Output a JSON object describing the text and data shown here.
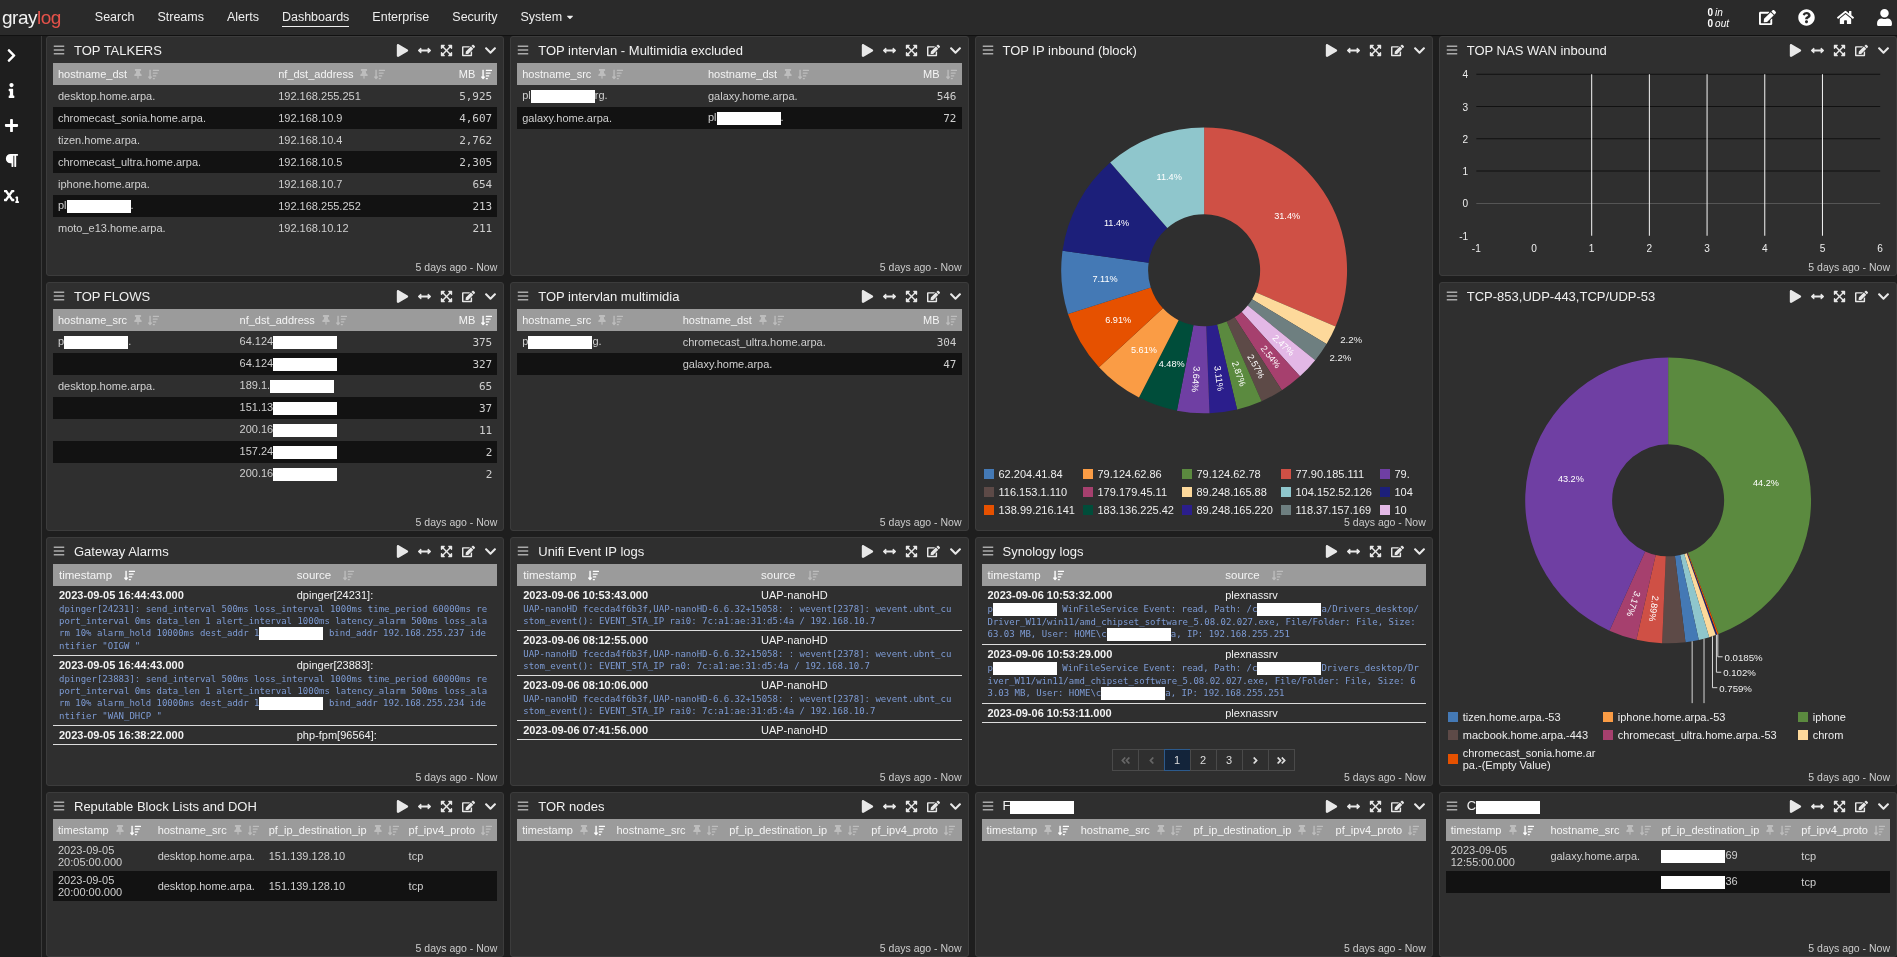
{
  "top_nav": {
    "logo": {
      "first": "gray",
      "second": "log"
    },
    "items": [
      {
        "label": "Search",
        "selected": false,
        "dropdown": false
      },
      {
        "label": "Streams",
        "selected": false,
        "dropdown": false
      },
      {
        "label": "Alerts",
        "selected": false,
        "dropdown": false
      },
      {
        "label": "Dashboards",
        "selected": true,
        "dropdown": false
      },
      {
        "label": "Enterprise",
        "selected": false,
        "dropdown": false
      },
      {
        "label": "Security",
        "selected": false,
        "dropdown": false
      },
      {
        "label": "System",
        "selected": false,
        "dropdown": true
      }
    ],
    "throughput": {
      "in_count": "0",
      "in_label": "in",
      "out_count": "0",
      "out_label": "out"
    }
  },
  "panels": [
    {
      "kind": "table",
      "title": "TOP TALKERS",
      "time_range": "5 days ago - Now",
      "columns": [
        {
          "label": "hostname_dst",
          "pin": true,
          "sorted": false,
          "kind": "text"
        },
        {
          "label": "nf_dst_address",
          "pin": true,
          "sorted": false,
          "kind": "text"
        },
        {
          "label": "MB",
          "pin": false,
          "sorted": true,
          "kind": "number"
        }
      ],
      "rows": [
        [
          "desktop.home.arpa.",
          "192.168.255.251",
          "5,925"
        ],
        [
          "chromecast_sonia.home.arpa.",
          "192.168.10.9",
          "4,607"
        ],
        [
          "tizen.home.arpa.",
          "192.168.10.4",
          "2,762"
        ],
        [
          "chromecast_ultra.home.arpa.",
          "192.168.10.5",
          "2,305"
        ],
        [
          "iphone.home.arpa.",
          "192.168.10.7",
          "654"
        ],
        [
          [
            {
              "kind": "text",
              "text": "pl"
            },
            {
              "kind": "redaction"
            },
            {
              "kind": "text",
              "text": "."
            }
          ],
          "192.168.255.252",
          "213"
        ],
        [
          "moto_e13.home.arpa.",
          "192.168.10.12",
          "211"
        ]
      ]
    },
    {
      "kind": "table",
      "title": "TOP intervlan - Multimidia excluded",
      "time_range": "5 days ago - Now",
      "columns": [
        {
          "label": "hostname_src",
          "pin": true,
          "sorted": false,
          "kind": "text"
        },
        {
          "label": "hostname_dst",
          "pin": true,
          "sorted": false,
          "kind": "text"
        },
        {
          "label": "MB",
          "pin": false,
          "sorted": false,
          "kind": "number"
        }
      ],
      "rows": [
        [
          [
            {
              "kind": "text",
              "text": "pl"
            },
            {
              "kind": "redaction"
            },
            {
              "kind": "text",
              "text": "rg."
            }
          ],
          "galaxy.home.arpa.",
          "546"
        ],
        [
          "galaxy.home.arpa.",
          [
            {
              "kind": "text",
              "text": "pl"
            },
            {
              "kind": "redaction"
            },
            {
              "kind": "text",
              "text": "."
            }
          ],
          "72"
        ]
      ]
    },
    {
      "kind": "donut",
      "title": "TOP IP inbound (block)",
      "time_range": "5 days ago - Now",
      "chart_data": {
        "type": "donut",
        "values": [
          31.4,
          2.2,
          2.2,
          2.47,
          2.54,
          2.57,
          2.87,
          3.11,
          3.64,
          4.48,
          5.61,
          6.91,
          7.11,
          11.4,
          11.4
        ],
        "value_labels": [
          "31.4%",
          "2.2%",
          "2.2%",
          "2.47%",
          "2.54%",
          "2.57%",
          "2.87%",
          "3.11%",
          "3.64%",
          "4.48%",
          "5.61%",
          "6.91%",
          "7.11%",
          "11.4%",
          "11.4%"
        ],
        "colors": [
          "#cf5045",
          "#fdd99b",
          "#6e7f80",
          "#e3b8e6",
          "#a6406e",
          "#5d4a47",
          "#5b8a3f",
          "#2b1e8c",
          "#6f3fa3",
          "#004d3a",
          "#fa9c45",
          "#e65100",
          "#4479b5",
          "#1c1f7a",
          "#8fc6cc"
        ]
      },
      "legend": [
        {
          "name": "62.204.41.84",
          "color": "#4479b5"
        },
        {
          "name": "79.124.62.86",
          "color": "#fa9c45"
        },
        {
          "name": "79.124.62.78",
          "color": "#5b8a3f"
        },
        {
          "name": "77.90.185.111",
          "color": "#cf5045"
        },
        {
          "name": "79.",
          "color": "#6f3fa3"
        },
        {
          "name": "116.153.1.110",
          "color": "#5d4a47"
        },
        {
          "name": "179.179.45.11",
          "color": "#a6406e"
        },
        {
          "name": "89.248.165.88",
          "color": "#fdd99b"
        },
        {
          "name": "104.152.52.126",
          "color": "#8fc6cc"
        },
        {
          "name": "104",
          "color": "#1c1f7a"
        },
        {
          "name": "138.99.216.141",
          "color": "#e65100"
        },
        {
          "name": "183.136.225.42",
          "color": "#004d3a"
        },
        {
          "name": "89.248.165.220",
          "color": "#2b1e8c"
        },
        {
          "name": "118.37.157.169",
          "color": "#6e7f80"
        },
        {
          "name": "10",
          "color": "#e3b8e6"
        }
      ]
    },
    {
      "kind": "line",
      "title": "TOP NAS WAN inbound",
      "time_range": "5 days ago - Now",
      "chart_data": {
        "type": "line",
        "xlim": [
          -1,
          6
        ],
        "ylim": [
          -1,
          4
        ],
        "xticks": [
          -1,
          0,
          1,
          2,
          3,
          4,
          5,
          6
        ],
        "yticks": [
          -1,
          0,
          1,
          2,
          3,
          4
        ],
        "grid": true
      }
    },
    {
      "kind": "table",
      "title": "TOP FLOWS",
      "time_range": "5 days ago - Now",
      "columns": [
        {
          "label": "hostname_src",
          "pin": true,
          "sorted": false,
          "kind": "text"
        },
        {
          "label": "nf_dst_address",
          "pin": true,
          "sorted": false,
          "kind": "text"
        },
        {
          "label": "MB",
          "pin": false,
          "sorted": true,
          "kind": "number"
        }
      ],
      "rows": [
        [
          [
            {
              "kind": "text",
              "text": "p"
            },
            {
              "kind": "redaction"
            },
            {
              "kind": "text",
              "text": "."
            }
          ],
          [
            {
              "kind": "text",
              "text": "64.124"
            },
            {
              "kind": "redaction"
            }
          ],
          "375"
        ],
        [
          null,
          [
            {
              "kind": "text",
              "text": "64.124"
            },
            {
              "kind": "redaction"
            }
          ],
          "327"
        ],
        [
          "desktop.home.arpa.",
          [
            {
              "kind": "text",
              "text": "189.1."
            },
            {
              "kind": "redaction"
            }
          ],
          "65"
        ],
        [
          null,
          [
            {
              "kind": "text",
              "text": "151.13"
            },
            {
              "kind": "redaction"
            }
          ],
          "37"
        ],
        [
          null,
          [
            {
              "kind": "text",
              "text": "200.16"
            },
            {
              "kind": "redaction"
            }
          ],
          "11"
        ],
        [
          null,
          [
            {
              "kind": "text",
              "text": "157.24"
            },
            {
              "kind": "redaction"
            }
          ],
          "2"
        ],
        [
          null,
          [
            {
              "kind": "text",
              "text": "200.16"
            },
            {
              "kind": "redaction"
            }
          ],
          "2"
        ]
      ]
    },
    {
      "kind": "table",
      "title": "TOP intervlan multimidia",
      "time_range": "5 days ago - Now",
      "columns": [
        {
          "label": "hostname_src",
          "pin": true,
          "sorted": false,
          "kind": "text"
        },
        {
          "label": "hostname_dst",
          "pin": true,
          "sorted": false,
          "kind": "text"
        },
        {
          "label": "MB",
          "pin": false,
          "sorted": false,
          "kind": "number"
        }
      ],
      "rows": [
        [
          [
            {
              "kind": "text",
              "text": "p"
            },
            {
              "kind": "redaction"
            },
            {
              "kind": "text",
              "text": "g."
            }
          ],
          "chromecast_ultra.home.arpa.",
          "304"
        ],
        [
          null,
          "galaxy.home.arpa.",
          "47"
        ]
      ]
    },
    {
      "kind": "messages",
      "title": "Gateway Alarms",
      "time_range": "5 days ago - Now",
      "columns": [
        {
          "label": "timestamp",
          "sorted": true
        },
        {
          "label": "source",
          "sorted": false
        }
      ],
      "messages": [
        {
          "timestamp": "2023-09-05 16:44:43.000",
          "source": "dpinger[24231]:",
          "message": [
            {
              "kind": "text",
              "text": "dpinger[24231]: send_interval 500ms loss_interval 1000ms time_period 60000ms report_interval 0ms data_len 1 alert_interval 1000ms latency_alarm 500ms loss_alarm 10% alarm_hold 10000ms dest_addr 1"
            },
            {
              "kind": "redaction"
            },
            {
              "kind": "text",
              "text": " bind_addr 192.168.255.237 identifier \"OIGW \""
            }
          ]
        },
        {
          "timestamp": "2023-09-05 16:44:43.000",
          "source": "dpinger[23883]:",
          "message": [
            {
              "kind": "text",
              "text": "dpinger[23883]: send_interval 500ms loss_interval 1000ms time_period 60000ms report_interval 0ms data_len 1 alert_interval 1000ms latency_alarm 500ms loss_alarm 10% alarm_hold 10000ms dest_addr 1"
            },
            {
              "kind": "redaction"
            },
            {
              "kind": "text",
              "text": " bind_addr 192.168.255.234 identifier \"WAN_DHCP \""
            }
          ]
        },
        {
          "timestamp": "2023-09-05 16:38:22.000",
          "source": "php-fpm[96564]:"
        }
      ]
    },
    {
      "kind": "messages",
      "title": "Unifi Event IP logs",
      "time_range": "5 days ago - Now",
      "columns": [
        {
          "label": "timestamp",
          "sorted": true
        },
        {
          "label": "source",
          "sorted": false
        }
      ],
      "messages": [
        {
          "timestamp": "2023-09-06 10:53:43.000",
          "source": "UAP-nanoHD",
          "message": "UAP-nanoHD fcecda4f6b3f,UAP-nanoHD-6.6.32+15058: : wevent[2378]: wevent.ubnt_custom_event(): EVENT_STA_IP rai0: 7c:a1:ae:31:d5:4a / 192.168.10.7"
        },
        {
          "timestamp": "2023-09-06 08:12:55.000",
          "source": "UAP-nanoHD",
          "message": "UAP-nanoHD fcecda4f6b3f,UAP-nanoHD-6.6.32+15058: : wevent[2378]: wevent.ubnt_custom_event(): EVENT_STA_IP ra0: 7c:a1:ae:31:d5:4a / 192.168.10.7"
        },
        {
          "timestamp": "2023-09-06 08:10:06.000",
          "source": "UAP-nanoHD",
          "message": "UAP-nanoHD fcecda4f6b3f,UAP-nanoHD-6.6.32+15058: : wevent[2378]: wevent.ubnt_custom_event(): EVENT_STA_IP rai0: 7c:a1:ae:31:d5:4a / 192.168.10.7"
        },
        {
          "timestamp": "2023-09-06 07:41:56.000",
          "source": "UAP-nanoHD"
        }
      ]
    },
    {
      "kind": "messages",
      "title": "Synology logs",
      "time_range": "5 days ago - Now",
      "columns": [
        {
          "label": "timestamp",
          "sorted": true
        },
        {
          "label": "source",
          "sorted": false
        }
      ],
      "messages": [
        {
          "timestamp": "2023-09-06 10:53:32.000",
          "source": "plexnassrv",
          "message": [
            {
              "kind": "text",
              "text": "p"
            },
            {
              "kind": "redaction"
            },
            {
              "kind": "text",
              "text": " WinFileService Event: read, Path: /c"
            },
            {
              "kind": "redaction"
            },
            {
              "kind": "text",
              "text": "a/Drivers_desktop/Driver_W11/win11/amd_chipset_software_5.08.02.027.exe, File/Folder: File, Size: 63.03 MB, User: HOME\\c"
            },
            {
              "kind": "redaction"
            },
            {
              "kind": "text",
              "text": "a, IP: 192.168.255.251"
            }
          ]
        },
        {
          "timestamp": "2023-09-06 10:53:29.000",
          "source": "plexnassrv",
          "message": [
            {
              "kind": "text",
              "text": "p"
            },
            {
              "kind": "redaction"
            },
            {
              "kind": "text",
              "text": " WinFileService Event: read, Path: /c"
            },
            {
              "kind": "redaction"
            },
            {
              "kind": "text",
              "text": "Drivers_desktop/Driver_W11/win11/amd_chipset_software_5.08.02.027.exe, File/Folder: File, Size: 63.03 MB, User: HOME\\c"
            },
            {
              "kind": "redaction"
            },
            {
              "kind": "text",
              "text": "a, IP: 192.168.255.251"
            }
          ]
        },
        {
          "timestamp": "2023-09-06 10:53:11.000",
          "source": "plexnassrv"
        }
      ],
      "pagination": {
        "prev_disabled": true,
        "next_disabled": false,
        "pages": [
          {
            "label": "1",
            "selected": true
          },
          {
            "label": "2",
            "selected": false
          },
          {
            "label": "3",
            "selected": false
          }
        ]
      }
    },
    {
      "kind": "donut",
      "title": "TCP-853,UDP-443,TCP/UDP-53",
      "time_range": "5 days ago - Now",
      "chart_data": {
        "type": "donut",
        "values": [
          44.2,
          0.0185,
          0.102,
          0.759,
          1.2,
          1.5,
          2.6,
          2.89,
          3.17,
          43.2
        ],
        "value_labels": [
          "44.2%",
          "0.0185%",
          "0.102%",
          "0.759%",
          null,
          null,
          null,
          "2.89%",
          "3.17%",
          "43.2%"
        ],
        "colors": [
          "#5b8a3f",
          "#e65100",
          "#1c1f7a",
          "#fdd99b",
          "#8fc6cc",
          "#4479b5",
          "#5d4a47",
          "#cf5045",
          "#a6406e",
          "#6f3fa3"
        ]
      },
      "legend": [
        {
          "name": "tizen.home.arpa.-53",
          "color": "#4479b5"
        },
        {
          "name": "iphone.home.arpa.-53",
          "color": "#fa9c45"
        },
        {
          "name": "iphone",
          "color": "#5b8a3f"
        },
        {
          "name": "macbook.home.arpa.-443",
          "color": "#5d4a47"
        },
        {
          "name": "chromecast_ultra.home.arpa.-53",
          "color": "#a6406e"
        },
        {
          "name": "chrom",
          "color": "#fdd99b"
        },
        {
          "name": "chromecast_sonia.home.arpa.-(Empty Value)",
          "color": "#e65100"
        }
      ]
    },
    {
      "kind": "table",
      "title": "Reputable Block Lists and DOH",
      "time_range": "5 days ago - Now",
      "columns": [
        {
          "label": "timestamp",
          "pin": true,
          "sorted": true,
          "kind": "text"
        },
        {
          "label": "hostname_src",
          "pin": true,
          "sorted": false,
          "kind": "text"
        },
        {
          "label": "pf_ip_destination_ip",
          "pin": true,
          "sorted": false,
          "kind": "text"
        },
        {
          "label": "pf_ipv4_proto",
          "pin": false,
          "sorted": false,
          "kind": "text"
        }
      ],
      "rows": [
        [
          "2023-09-05 20:05:00.000",
          "desktop.home.arpa.",
          "151.139.128.10",
          "tcp"
        ],
        [
          "2023-09-05 20:00:00.000",
          "desktop.home.arpa.",
          "151.139.128.10",
          "tcp"
        ]
      ]
    },
    {
      "kind": "table",
      "title": "TOR nodes",
      "time_range": "5 days ago - Now",
      "columns": [
        {
          "label": "timestamp",
          "pin": true,
          "sorted": true,
          "kind": "text"
        },
        {
          "label": "hostname_src",
          "pin": true,
          "sorted": false,
          "kind": "text"
        },
        {
          "label": "pf_ip_destination_ip",
          "pin": true,
          "sorted": false,
          "kind": "text"
        },
        {
          "label": "pf_ipv4_proto",
          "pin": false,
          "sorted": false,
          "kind": "text"
        }
      ]
    },
    {
      "kind": "table",
      "title": [
        {
          "kind": "text",
          "text": "F"
        },
        {
          "kind": "redaction"
        }
      ],
      "time_range": "5 days ago - Now",
      "columns": [
        {
          "label": "timestamp",
          "pin": true,
          "sorted": true,
          "kind": "text"
        },
        {
          "label": "hostname_src",
          "pin": true,
          "sorted": false,
          "kind": "text"
        },
        {
          "label": "pf_ip_destination_ip",
          "pin": true,
          "sorted": false,
          "kind": "text"
        },
        {
          "label": "pf_ipv4_proto",
          "pin": false,
          "sorted": false,
          "kind": "text"
        }
      ]
    },
    {
      "kind": "table",
      "title": [
        {
          "kind": "text",
          "text": "C"
        },
        {
          "kind": "redaction"
        }
      ],
      "time_range": "5 days ago - Now",
      "columns": [
        {
          "label": "timestamp",
          "pin": true,
          "sorted": true,
          "kind": "text"
        },
        {
          "label": "hostname_src",
          "pin": true,
          "sorted": false,
          "kind": "text"
        },
        {
          "label": "pf_ip_destination_ip",
          "pin": true,
          "sorted": false,
          "kind": "text"
        },
        {
          "label": "pf_ipv4_proto",
          "pin": false,
          "sorted": false,
          "kind": "text"
        }
      ],
      "rows": [
        [
          "2023-09-05 12:55:00.000",
          "galaxy.home.arpa.",
          [
            {
              "kind": "redaction"
            },
            {
              "kind": "text",
              "text": "69"
            }
          ],
          "tcp"
        ],
        [
          null,
          null,
          [
            {
              "kind": "redaction"
            },
            {
              "kind": "text",
              "text": "36"
            }
          ],
          "tcp"
        ]
      ]
    }
  ]
}
